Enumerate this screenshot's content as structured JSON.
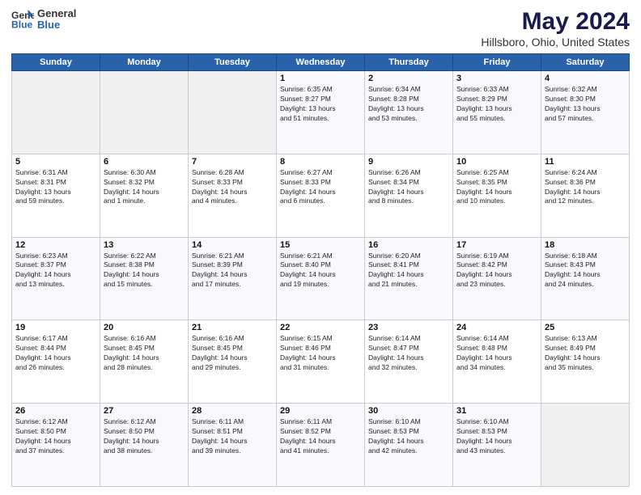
{
  "header": {
    "logo_line1": "General",
    "logo_line2": "Blue",
    "main_title": "May 2024",
    "sub_title": "Hillsboro, Ohio, United States"
  },
  "days_of_week": [
    "Sunday",
    "Monday",
    "Tuesday",
    "Wednesday",
    "Thursday",
    "Friday",
    "Saturday"
  ],
  "weeks": [
    [
      {
        "day": "",
        "info": ""
      },
      {
        "day": "",
        "info": ""
      },
      {
        "day": "",
        "info": ""
      },
      {
        "day": "1",
        "info": "Sunrise: 6:35 AM\nSunset: 8:27 PM\nDaylight: 13 hours\nand 51 minutes."
      },
      {
        "day": "2",
        "info": "Sunrise: 6:34 AM\nSunset: 8:28 PM\nDaylight: 13 hours\nand 53 minutes."
      },
      {
        "day": "3",
        "info": "Sunrise: 6:33 AM\nSunset: 8:29 PM\nDaylight: 13 hours\nand 55 minutes."
      },
      {
        "day": "4",
        "info": "Sunrise: 6:32 AM\nSunset: 8:30 PM\nDaylight: 13 hours\nand 57 minutes."
      }
    ],
    [
      {
        "day": "5",
        "info": "Sunrise: 6:31 AM\nSunset: 8:31 PM\nDaylight: 13 hours\nand 59 minutes."
      },
      {
        "day": "6",
        "info": "Sunrise: 6:30 AM\nSunset: 8:32 PM\nDaylight: 14 hours\nand 1 minute."
      },
      {
        "day": "7",
        "info": "Sunrise: 6:28 AM\nSunset: 8:33 PM\nDaylight: 14 hours\nand 4 minutes."
      },
      {
        "day": "8",
        "info": "Sunrise: 6:27 AM\nSunset: 8:33 PM\nDaylight: 14 hours\nand 6 minutes."
      },
      {
        "day": "9",
        "info": "Sunrise: 6:26 AM\nSunset: 8:34 PM\nDaylight: 14 hours\nand 8 minutes."
      },
      {
        "day": "10",
        "info": "Sunrise: 6:25 AM\nSunset: 8:35 PM\nDaylight: 14 hours\nand 10 minutes."
      },
      {
        "day": "11",
        "info": "Sunrise: 6:24 AM\nSunset: 8:36 PM\nDaylight: 14 hours\nand 12 minutes."
      }
    ],
    [
      {
        "day": "12",
        "info": "Sunrise: 6:23 AM\nSunset: 8:37 PM\nDaylight: 14 hours\nand 13 minutes."
      },
      {
        "day": "13",
        "info": "Sunrise: 6:22 AM\nSunset: 8:38 PM\nDaylight: 14 hours\nand 15 minutes."
      },
      {
        "day": "14",
        "info": "Sunrise: 6:21 AM\nSunset: 8:39 PM\nDaylight: 14 hours\nand 17 minutes."
      },
      {
        "day": "15",
        "info": "Sunrise: 6:21 AM\nSunset: 8:40 PM\nDaylight: 14 hours\nand 19 minutes."
      },
      {
        "day": "16",
        "info": "Sunrise: 6:20 AM\nSunset: 8:41 PM\nDaylight: 14 hours\nand 21 minutes."
      },
      {
        "day": "17",
        "info": "Sunrise: 6:19 AM\nSunset: 8:42 PM\nDaylight: 14 hours\nand 23 minutes."
      },
      {
        "day": "18",
        "info": "Sunrise: 6:18 AM\nSunset: 8:43 PM\nDaylight: 14 hours\nand 24 minutes."
      }
    ],
    [
      {
        "day": "19",
        "info": "Sunrise: 6:17 AM\nSunset: 8:44 PM\nDaylight: 14 hours\nand 26 minutes."
      },
      {
        "day": "20",
        "info": "Sunrise: 6:16 AM\nSunset: 8:45 PM\nDaylight: 14 hours\nand 28 minutes."
      },
      {
        "day": "21",
        "info": "Sunrise: 6:16 AM\nSunset: 8:45 PM\nDaylight: 14 hours\nand 29 minutes."
      },
      {
        "day": "22",
        "info": "Sunrise: 6:15 AM\nSunset: 8:46 PM\nDaylight: 14 hours\nand 31 minutes."
      },
      {
        "day": "23",
        "info": "Sunrise: 6:14 AM\nSunset: 8:47 PM\nDaylight: 14 hours\nand 32 minutes."
      },
      {
        "day": "24",
        "info": "Sunrise: 6:14 AM\nSunset: 8:48 PM\nDaylight: 14 hours\nand 34 minutes."
      },
      {
        "day": "25",
        "info": "Sunrise: 6:13 AM\nSunset: 8:49 PM\nDaylight: 14 hours\nand 35 minutes."
      }
    ],
    [
      {
        "day": "26",
        "info": "Sunrise: 6:12 AM\nSunset: 8:50 PM\nDaylight: 14 hours\nand 37 minutes."
      },
      {
        "day": "27",
        "info": "Sunrise: 6:12 AM\nSunset: 8:50 PM\nDaylight: 14 hours\nand 38 minutes."
      },
      {
        "day": "28",
        "info": "Sunrise: 6:11 AM\nSunset: 8:51 PM\nDaylight: 14 hours\nand 39 minutes."
      },
      {
        "day": "29",
        "info": "Sunrise: 6:11 AM\nSunset: 8:52 PM\nDaylight: 14 hours\nand 41 minutes."
      },
      {
        "day": "30",
        "info": "Sunrise: 6:10 AM\nSunset: 8:53 PM\nDaylight: 14 hours\nand 42 minutes."
      },
      {
        "day": "31",
        "info": "Sunrise: 6:10 AM\nSunset: 8:53 PM\nDaylight: 14 hours\nand 43 minutes."
      },
      {
        "day": "",
        "info": ""
      }
    ]
  ]
}
